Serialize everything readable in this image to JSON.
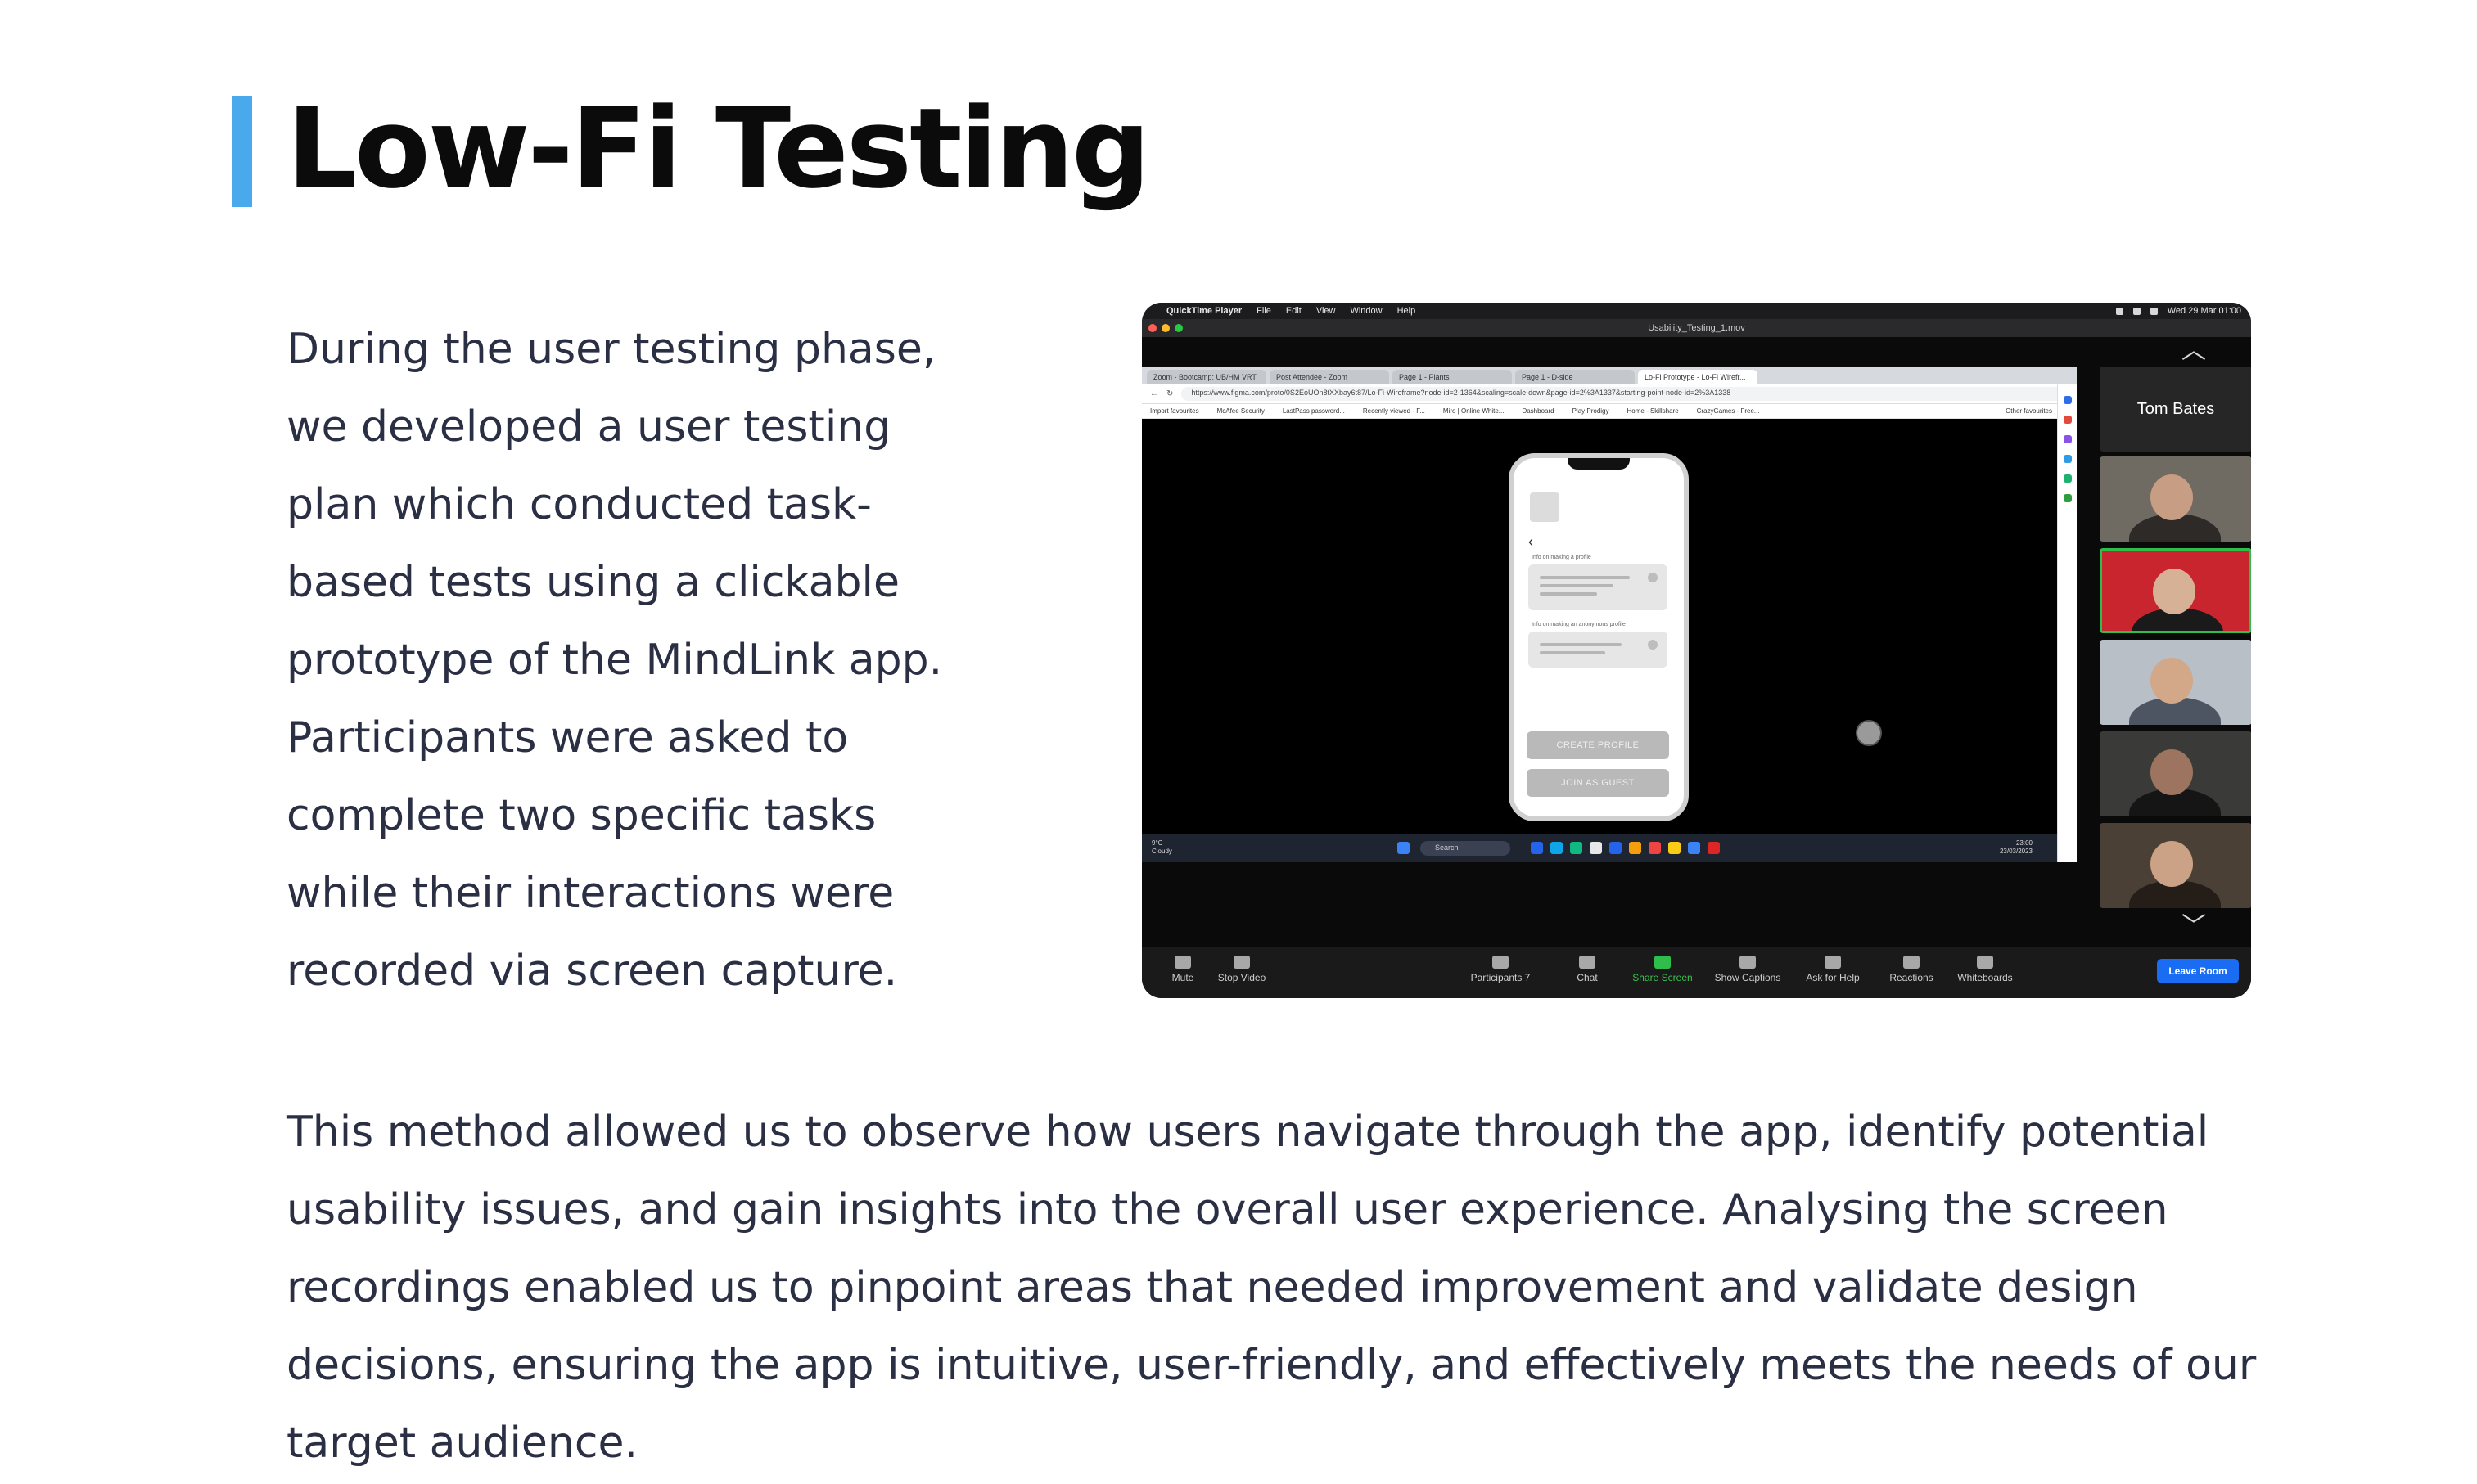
{
  "page": {
    "title": "Low-Fi Testing",
    "intro_lines": [
      "During the user testing phase,",
      "we developed a user testing",
      "plan which conducted task-",
      "based tests using a clickable",
      "prototype of the MindLink app.",
      "Participants were asked to",
      "complete two specific tasks",
      "while their interactions were",
      "recorded via screen capture."
    ],
    "outro_lines": [
      "This method allowed us to observe how users navigate through the app, identify potential",
      "usability issues, and gain insights into the overall user experience. Analysing the screen",
      "recordings enabled us to pinpoint areas that needed improvement and validate design",
      "decisions, ensuring the app is intuitive, user-friendly, and effectively meets the needs of our",
      "target audience."
    ]
  },
  "colors": {
    "accent": "#4aa8ec",
    "title": "#0b0b0b",
    "body_text": "#2b2f44",
    "zoom_green": "#2fbe4b",
    "zoom_blue": "#1a6df2"
  },
  "screenshot": {
    "mac_menubar": {
      "app": "QuickTime Player",
      "menus": [
        "File",
        "Edit",
        "View",
        "Window",
        "Help"
      ],
      "datetime": "Wed 29 Mar  01:00"
    },
    "qt_window_title": "Usability_Testing_1.mov",
    "browser": {
      "tabs": [
        "Zoom - Bootcamp: UB/HM VRT",
        "Post Attendee - Zoom",
        "Page 1 - Plants",
        "Page 1 - D-side",
        "Lo-Fi Prototype - Lo-Fi Wirefr..."
      ],
      "url": "https://www.figma.com/proto/0S2EoUOn8tXXbay6t87/Lo-Fi-Wireframe?node-id=2-1364&scaling=scale-down&page-id=2%3A1337&starting-point-node-id=2%3A1338",
      "favourites": [
        "Import favourites",
        "McAfee Security",
        "LastPass password...",
        "Recently viewed - F...",
        "Miro | Online White...",
        "Dashboard",
        "Play Prodigy",
        "Home - Skillshare",
        "CrazyGames - Free...",
        "Other favourites"
      ]
    },
    "prototype": {
      "label_profile": "Info on making a profile",
      "label_anonymous": "Info on making an anonymous profile",
      "create_profile": "CREATE PROFILE",
      "join_guest": "JOIN AS GUEST"
    },
    "windows_taskbar": {
      "weather_temp": "9°C",
      "weather_desc": "Cloudy",
      "search": "Search",
      "time": "23:00",
      "date": "23/03/2023"
    },
    "gallery": {
      "host_name": "Tom Bates"
    },
    "zoom_toolbar": {
      "mute": "Mute",
      "stop_video": "Stop Video",
      "participants": "Participants",
      "participants_count": "7",
      "chat": "Chat",
      "share_screen": "Share Screen",
      "show_captions": "Show Captions",
      "ask_for_help": "Ask for Help",
      "reactions": "Reactions",
      "whiteboards": "Whiteboards",
      "leave_room": "Leave Room"
    }
  }
}
